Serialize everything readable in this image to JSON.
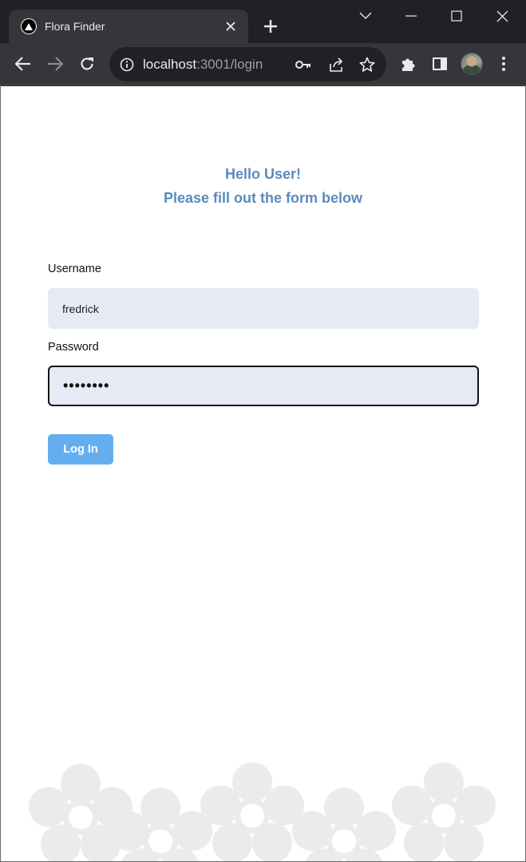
{
  "browser": {
    "tab_title": "Flora Finder",
    "url_host": "localhost",
    "url_rest": ":3001/login"
  },
  "page": {
    "greeting_line1": "Hello User!",
    "greeting_line2": "Please fill out the form below",
    "username_label": "Username",
    "username_value": "fredrick",
    "password_label": "Password",
    "password_value": "••••••••",
    "login_button": "Log In"
  },
  "colors": {
    "accent_text": "#5b8bbc",
    "button": "#64aef0",
    "input_bg": "#e5eaf4"
  }
}
